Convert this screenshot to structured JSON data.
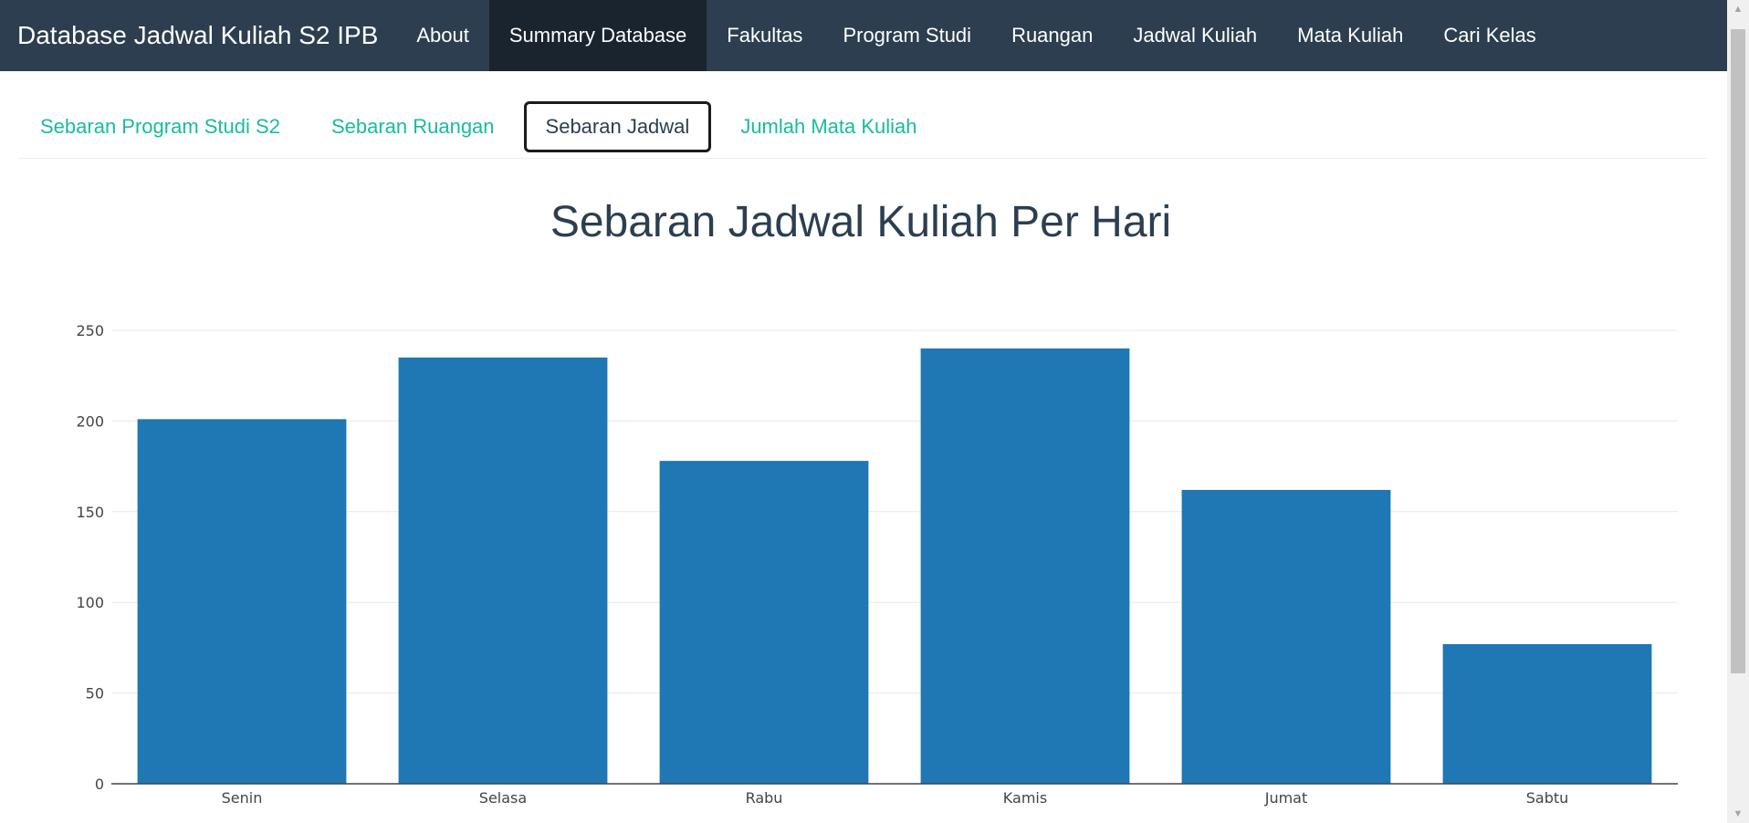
{
  "navbar": {
    "brand": "Database Jadwal Kuliah S2 IPB",
    "items": [
      "About",
      "Summary Database",
      "Fakultas",
      "Program Studi",
      "Ruangan",
      "Jadwal Kuliah",
      "Mata Kuliah",
      "Cari Kelas"
    ],
    "active_index": 1
  },
  "tabs": {
    "items": [
      "Sebaran Program Studi S2",
      "Sebaran Ruangan",
      "Sebaran Jadwal",
      "Jumlah Mata Kuliah"
    ],
    "active_index": 2
  },
  "colors": {
    "navbar": "#2c3e50",
    "tab_link": "#18bc9c",
    "bar": "#1f77b4"
  },
  "chart_data": {
    "type": "bar",
    "title": "Sebaran Jadwal Kuliah Per Hari",
    "categories": [
      "Senin",
      "Selasa",
      "Rabu",
      "Kamis",
      "Jumat",
      "Sabtu"
    ],
    "values": [
      201,
      235,
      178,
      240,
      162,
      77
    ],
    "ylim": [
      0,
      250
    ],
    "yticks": [
      0,
      50,
      100,
      150,
      200,
      250
    ],
    "xlabel": "",
    "ylabel": "",
    "grid": true,
    "bar_color": "#1f77b4"
  }
}
